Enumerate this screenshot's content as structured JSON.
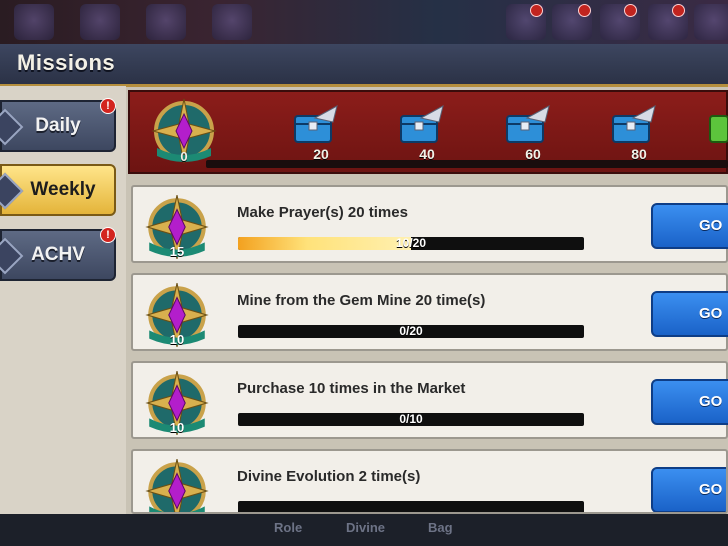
{
  "window": {
    "title": "Missions"
  },
  "tabs": [
    {
      "label": "Daily",
      "active": false,
      "alert": true
    },
    {
      "label": "Weekly",
      "active": true,
      "alert": false
    },
    {
      "label": "ACHV",
      "active": false,
      "alert": true
    }
  ],
  "reward_track": {
    "current_points": "0",
    "milestones": [
      {
        "points": "20"
      },
      {
        "points": "40"
      },
      {
        "points": "60"
      },
      {
        "points": "80"
      }
    ]
  },
  "missions": [
    {
      "title": "Make Prayer(s) 20 times",
      "points": "15",
      "progress_text": "10/20",
      "progress": 0.5,
      "button": "GO"
    },
    {
      "title": "Mine from the Gem Mine 20 time(s)",
      "points": "10",
      "progress_text": "0/20",
      "progress": 0,
      "button": "GO"
    },
    {
      "title": "Purchase 10 times in the Market",
      "points": "10",
      "progress_text": "0/10",
      "progress": 0,
      "button": "GO"
    },
    {
      "title": "Divine Evolution 2 time(s)",
      "points": "",
      "progress_text": "",
      "progress": 0,
      "button": "GO"
    }
  ],
  "bottom_nav": [
    {
      "label": "Role"
    },
    {
      "label": "Divine"
    },
    {
      "label": "Bag"
    }
  ],
  "colors": {
    "accent_gold": "#e4b43a",
    "go_button": "#1a62c8",
    "reward_banner": "#8c1d1a",
    "alert": "#d3241f"
  },
  "icons": {
    "tab_emblem": "diamond-emblem-icon",
    "points_emblem": "compass-star-gem-icon",
    "milestone_chest": "winged-chest-icon",
    "alert_badge": "exclamation-icon"
  }
}
